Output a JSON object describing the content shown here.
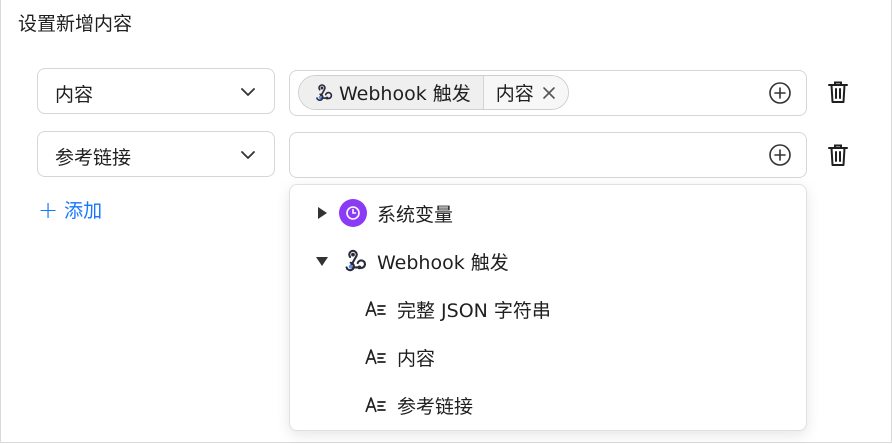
{
  "section_title": "设置新增内容",
  "rows": [
    {
      "field_select": "内容",
      "tag_source": "Webhook 触发",
      "tag_field": "内容"
    },
    {
      "field_select": "参考链接",
      "value_placeholder": ""
    }
  ],
  "add_label": "添加",
  "dropdown": {
    "groups": [
      {
        "label": "系统变量",
        "expanded": false,
        "icon": "clock-icon"
      },
      {
        "label": "Webhook 触发",
        "expanded": true,
        "icon": "webhook-icon",
        "items": [
          "完整 JSON 字符串",
          "内容",
          "参考链接"
        ]
      }
    ]
  },
  "colors": {
    "accent": "#1677ff",
    "system_var_icon": "#8b3bf5"
  }
}
